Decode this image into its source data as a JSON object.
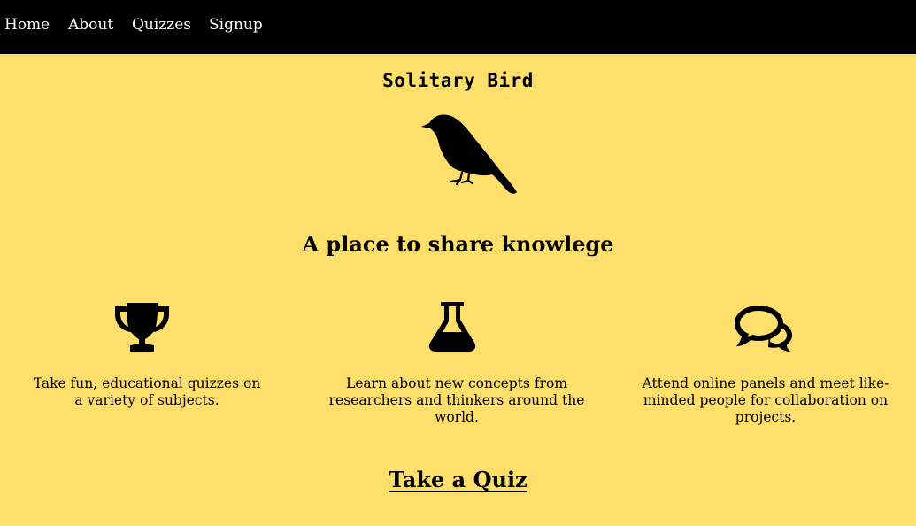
{
  "nav": {
    "items": [
      {
        "label": "Home"
      },
      {
        "label": "About"
      },
      {
        "label": "Quizzes"
      },
      {
        "label": "Signup"
      }
    ]
  },
  "hero": {
    "title": "Solitary Bird",
    "logo_icon": "bird-silhouette",
    "tagline": "A place to share knowlege"
  },
  "features": [
    {
      "icon": "trophy-icon",
      "text": "Take fun, educational quizzes on a variety of subjects."
    },
    {
      "icon": "flask-icon",
      "text": "Learn about new concepts from researchers and thinkers around the world."
    },
    {
      "icon": "comments-icon",
      "text": "Attend online panels and meet like-minded people for collaboration on projects."
    }
  ],
  "cta": {
    "label": "Take a Quiz"
  },
  "colors": {
    "background": "#ffdf6b",
    "navbar": "#000000",
    "nav_text": "#ffffff",
    "text": "#000000"
  }
}
